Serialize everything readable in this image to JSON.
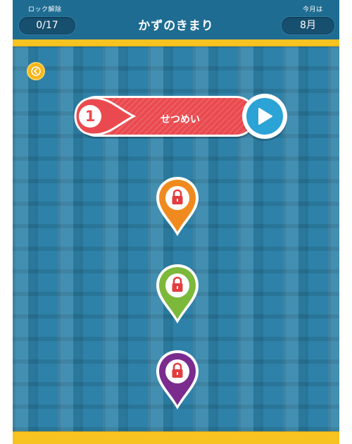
{
  "header": {
    "unlock_label": "ロック解除",
    "unlock_count": "0/17",
    "title": "かずのきまり",
    "month_label": "今月は",
    "month_value": "8月"
  },
  "level": {
    "number": "1",
    "label": "せつめい"
  },
  "pins": [
    {
      "color": "#f08a1e",
      "state": "locked",
      "icon": "lock-icon"
    },
    {
      "color": "#7cb83a",
      "state": "locked",
      "icon": "lock-icon"
    },
    {
      "color": "#7b2b8e",
      "state": "locked",
      "icon": "lock-icon"
    }
  ],
  "colors": {
    "header_bg": "#1f6c92",
    "accent_yellow": "#f7c321",
    "board_bg": "#2e82a9",
    "banner_red": "#ea4a4f",
    "play_blue": "#2ba3d6",
    "back_button": "#f8b418"
  }
}
